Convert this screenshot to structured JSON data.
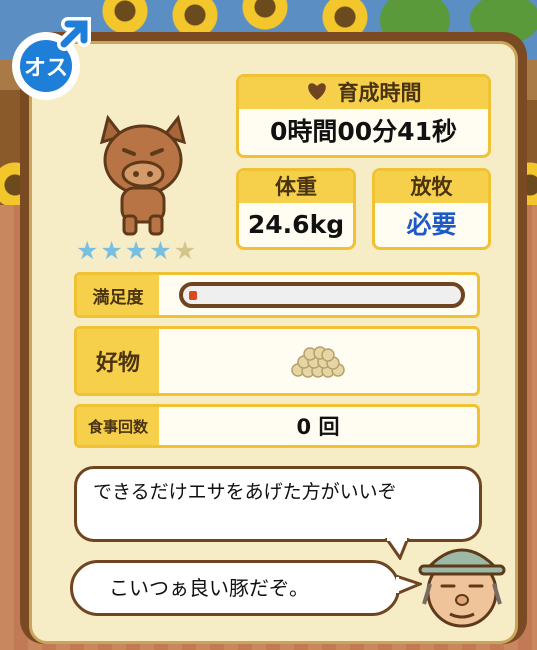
{
  "gender": {
    "label": "オス",
    "symbol": "♂",
    "color": "#1f7fd8"
  },
  "pig": {
    "rating": 4,
    "max_rating": 5
  },
  "stats": {
    "raising_time": {
      "label": "育成時間",
      "value": "0時間00分41秒"
    },
    "weight": {
      "label": "体重",
      "value": "24.6kg"
    },
    "grazing": {
      "label": "放牧",
      "value": "必要"
    }
  },
  "rows": {
    "satisfaction": {
      "label": "満足度",
      "level_percent": 3
    },
    "favorite": {
      "label": "好物",
      "food_icon": "feed-grain-icon"
    },
    "meals": {
      "label": "食事回数",
      "value": "0 回"
    }
  },
  "speech": {
    "advice": "できるだけエサをあげた方がいいぞ",
    "comment": "こいつぁ良い豚だぞ。"
  },
  "colors": {
    "accent": "#f6d04b",
    "frame": "#7a4a23",
    "panel": "#f6ecc6",
    "star": "#79bfe0",
    "need": "#1c5ac8"
  }
}
